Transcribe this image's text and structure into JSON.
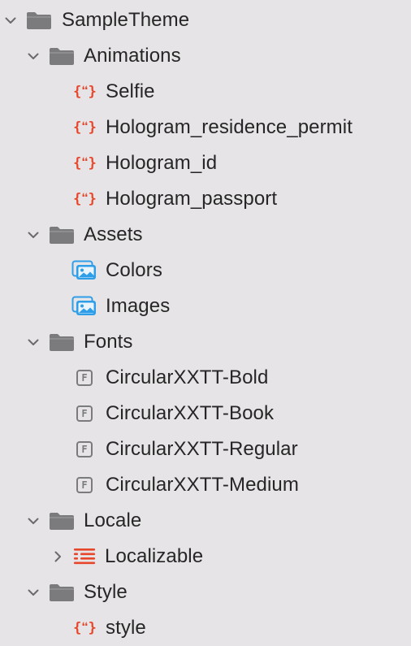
{
  "tree": [
    {
      "label": "SampleTheme",
      "type": "folder",
      "depth": 0,
      "expanded": true
    },
    {
      "label": "Animations",
      "type": "folder",
      "depth": 1,
      "expanded": true
    },
    {
      "label": "Selfie",
      "type": "json",
      "depth": 2
    },
    {
      "label": "Hologram_residence_permit",
      "type": "json",
      "depth": 2
    },
    {
      "label": "Hologram_id",
      "type": "json",
      "depth": 2
    },
    {
      "label": "Hologram_passport",
      "type": "json",
      "depth": 2
    },
    {
      "label": "Assets",
      "type": "folder",
      "depth": 1,
      "expanded": true
    },
    {
      "label": "Colors",
      "type": "asset-catalog",
      "depth": 2
    },
    {
      "label": "Images",
      "type": "asset-catalog",
      "depth": 2
    },
    {
      "label": "Fonts",
      "type": "folder",
      "depth": 1,
      "expanded": true
    },
    {
      "label": "CircularXXTT-Bold",
      "type": "font",
      "depth": 2
    },
    {
      "label": "CircularXXTT-Book",
      "type": "font",
      "depth": 2
    },
    {
      "label": "CircularXXTT-Regular",
      "type": "font",
      "depth": 2
    },
    {
      "label": "CircularXXTT-Medium",
      "type": "font",
      "depth": 2
    },
    {
      "label": "Locale",
      "type": "folder",
      "depth": 1,
      "expanded": true
    },
    {
      "label": "Localizable",
      "type": "strings",
      "depth": 2,
      "expanded": false
    },
    {
      "label": "Style",
      "type": "folder",
      "depth": 1,
      "expanded": true
    },
    {
      "label": "style",
      "type": "json",
      "depth": 2
    }
  ],
  "icons": {
    "folder": "folder-icon",
    "json": "json-file-icon",
    "asset-catalog": "asset-catalog-icon",
    "font": "font-file-icon",
    "strings": "strings-file-icon",
    "chevron_expanded": "chevron-down-icon",
    "chevron_collapsed": "chevron-right-icon"
  },
  "colors": {
    "background": "#e6e4e6",
    "text": "#262626",
    "folder": "#7b7b7e",
    "json_accent": "#e8462a",
    "asset_accent": "#2f9ee8",
    "chevron": "#6a6a6d"
  }
}
